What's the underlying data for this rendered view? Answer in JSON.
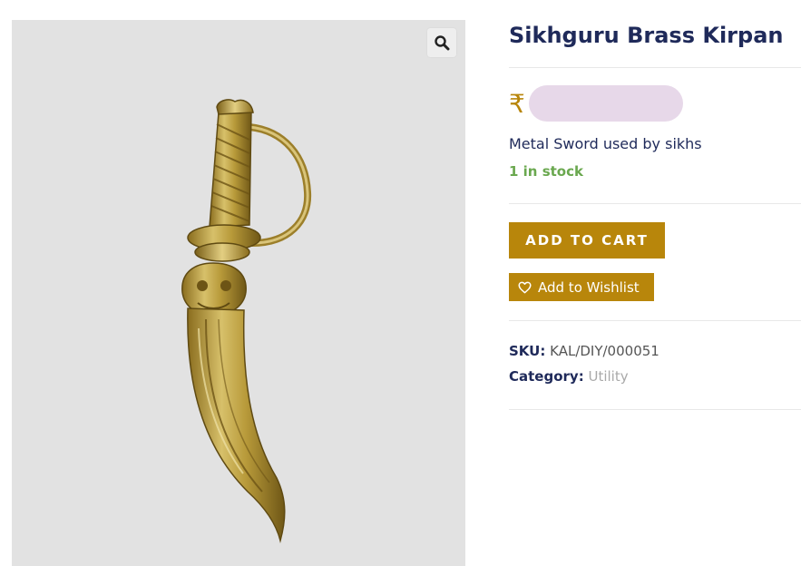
{
  "product": {
    "title": "Sikhguru Brass Kirpan",
    "currency_symbol": "₹",
    "description": "Metal Sword used by sikhs",
    "stock_status": "1 in stock"
  },
  "actions": {
    "add_to_cart": "ADD TO CART",
    "add_to_wishlist": "Add to Wishlist"
  },
  "meta": {
    "sku_label": "SKU:",
    "sku_value": "KAL/DIY/000051",
    "category_label": "Category:",
    "category_value": "Utility"
  },
  "icons": {
    "zoom": "search-icon",
    "wishlist": "heart-icon"
  },
  "colors": {
    "accent": "#b8860b",
    "title": "#1f2a5a",
    "stock": "#6aa84f",
    "image_background": "#e2e2e2"
  }
}
